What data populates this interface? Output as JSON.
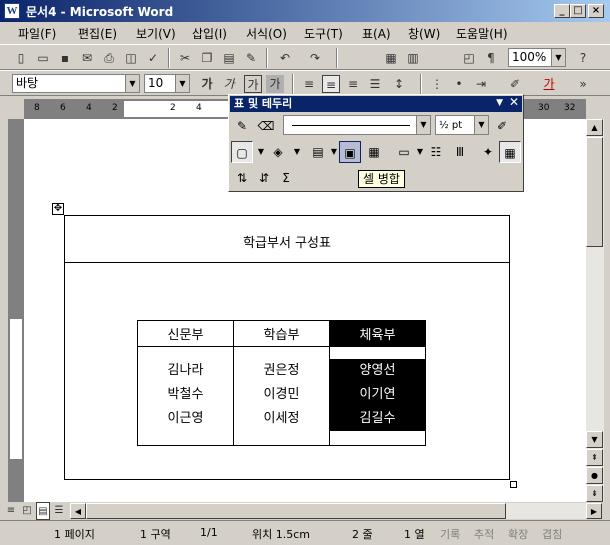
{
  "window": {
    "app_icon": "W",
    "title": "문서4 - Microsoft Word",
    "min_label": "_",
    "max_label": "□",
    "close_label": "×"
  },
  "menu": [
    "파일(F)",
    "편집(E)",
    "보기(V)",
    "삽입(I)",
    "서식(O)",
    "도구(T)",
    "표(A)",
    "창(W)",
    "도움말(H)"
  ],
  "standard_toolbar": {
    "zoom": "100%"
  },
  "formatting_toolbar": {
    "font": "바탕",
    "size": "10",
    "char_buttons": [
      "가",
      "가",
      "가",
      "가"
    ]
  },
  "ruler": {
    "numbers": [
      "8",
      "6",
      "4",
      "2",
      "2",
      "4",
      "30",
      "32"
    ]
  },
  "floating_toolbar": {
    "title": "표 및 테두리",
    "line_weight": "½ pt",
    "sigma": "Σ"
  },
  "tooltip": "셀 병합",
  "document": {
    "outer_title": "학급부서 구성표",
    "move_handle": "✥",
    "inner_table": {
      "headers": [
        "신문부",
        "학습부",
        "체육부"
      ],
      "columns": [
        [
          "김나라",
          "박철수",
          "이근영"
        ],
        [
          "권은정",
          "이경민",
          "이세정"
        ],
        [
          "양영선",
          "이기연",
          "김길수"
        ]
      ]
    }
  },
  "status": {
    "page": "1 페이지",
    "section": "1 구역",
    "pages": "1/1",
    "position": "위치 1.5cm",
    "line": "2 줄",
    "col": "1 열",
    "rec": "기록",
    "trk": "추적",
    "ext": "확장",
    "ovr": "겹침"
  },
  "colors": {
    "titlebar": "#0a246a",
    "selection": "#000000",
    "tooltip_bg": "#ffffe1"
  }
}
